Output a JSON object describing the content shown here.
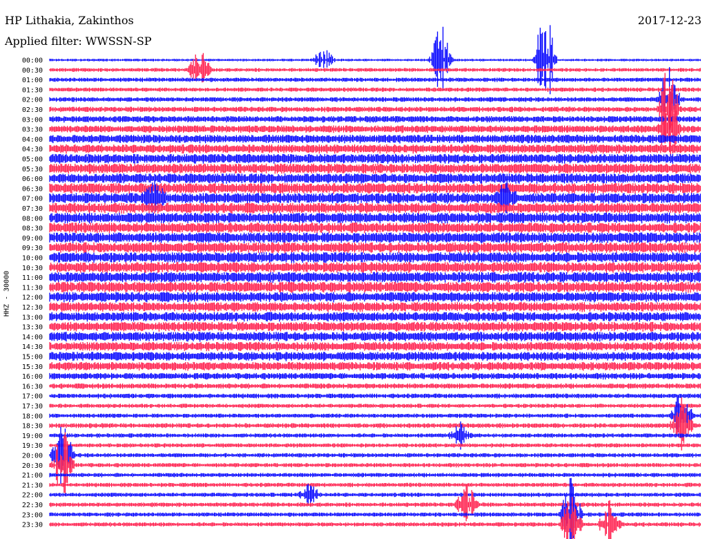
{
  "header": {
    "station": "HP Lithakia, Zakinthos",
    "filter": "Applied filter: WWSSN-SP",
    "date": "2017-12-23"
  },
  "chart_data": {
    "type": "line",
    "title": "HP Lithakia, Zakinthos",
    "subtitle": "Applied filter: WWSSN-SP",
    "date": "2017-12-23",
    "ylabel": "HHZ - 30000",
    "rows": [
      "00:00",
      "00:30",
      "01:00",
      "01:30",
      "02:00",
      "02:30",
      "03:00",
      "03:30",
      "04:00",
      "04:30",
      "05:00",
      "05:30",
      "06:00",
      "06:30",
      "07:00",
      "07:30",
      "08:00",
      "08:30",
      "09:00",
      "09:30",
      "10:00",
      "10:30",
      "11:00",
      "11:30",
      "12:00",
      "12:30",
      "13:00",
      "13:30",
      "14:00",
      "14:30",
      "15:00",
      "15:30",
      "16:00",
      "16:30",
      "17:00",
      "17:30",
      "18:00",
      "18:30",
      "19:00",
      "19:30",
      "20:00",
      "20:30",
      "21:00",
      "21:30",
      "22:00",
      "22:30",
      "23:00",
      "23:30"
    ],
    "colors": [
      "#0000ff",
      "#ff1a4a"
    ],
    "trace_amplitude": [
      0.25,
      0.35,
      0.4,
      0.4,
      0.45,
      0.5,
      0.6,
      0.7,
      0.8,
      0.85,
      0.9,
      0.95,
      0.95,
      1.0,
      1.0,
      1.0,
      1.0,
      1.0,
      1.0,
      1.0,
      1.0,
      1.0,
      1.0,
      1.0,
      0.95,
      0.9,
      0.9,
      0.9,
      0.9,
      0.85,
      0.85,
      0.8,
      0.6,
      0.5,
      0.45,
      0.4,
      0.4,
      0.45,
      0.4,
      0.4,
      0.4,
      0.4,
      0.4,
      0.4,
      0.4,
      0.4,
      0.4,
      0.4
    ],
    "events": [
      {
        "row": 0,
        "x": 0.42,
        "amp": 2.5
      },
      {
        "row": 0,
        "x": 0.6,
        "amp": 9
      },
      {
        "row": 0,
        "x": 0.76,
        "amp": 11
      },
      {
        "row": 1,
        "x": 0.23,
        "amp": 4
      },
      {
        "row": 4,
        "x": 0.95,
        "amp": 6
      },
      {
        "row": 5,
        "x": 0.95,
        "amp": 10
      },
      {
        "row": 7,
        "x": 0.95,
        "amp": 8
      },
      {
        "row": 14,
        "x": 0.16,
        "amp": 3
      },
      {
        "row": 14,
        "x": 0.7,
        "amp": 3
      },
      {
        "row": 38,
        "x": 0.63,
        "amp": 3
      },
      {
        "row": 40,
        "x": 0.02,
        "amp": 6
      },
      {
        "row": 41,
        "x": 0.02,
        "amp": 7
      },
      {
        "row": 44,
        "x": 0.4,
        "amp": 3
      },
      {
        "row": 45,
        "x": 0.64,
        "amp": 4
      },
      {
        "row": 46,
        "x": 0.8,
        "amp": 7
      },
      {
        "row": 47,
        "x": 0.8,
        "amp": 6
      },
      {
        "row": 47,
        "x": 0.86,
        "amp": 5
      },
      {
        "row": 36,
        "x": 0.97,
        "amp": 5
      },
      {
        "row": 37,
        "x": 0.97,
        "amp": 5
      }
    ]
  }
}
